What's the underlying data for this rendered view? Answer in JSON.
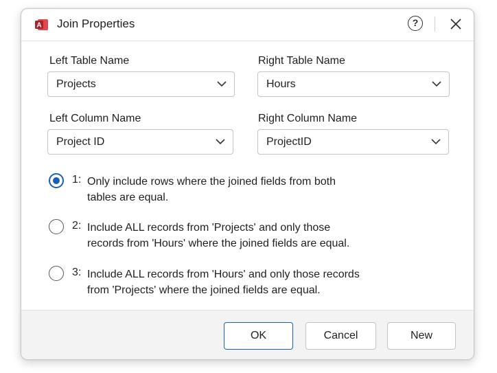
{
  "dialog": {
    "title": "Join Properties",
    "app_icon": "access-app-icon",
    "help_label": "?",
    "close_icon": "close-icon"
  },
  "fields": {
    "left_table_label": "Left Table Name",
    "left_table_value": "Projects",
    "right_table_label": "Right Table Name",
    "right_table_value": "Hours",
    "left_column_label": "Left Column Name",
    "left_column_value": "Project ID",
    "right_column_label": "Right Column Name",
    "right_column_value": "ProjectID"
  },
  "options": [
    {
      "num": "1:",
      "line1": "Only include rows where the joined fields from both",
      "line2": "tables are equal.",
      "selected": true
    },
    {
      "num": "2:",
      "line1": "Include ALL records from 'Projects' and only those",
      "line2": "records from 'Hours' where the joined fields are equal.",
      "selected": false
    },
    {
      "num": "3:",
      "line1": "Include ALL records from 'Hours' and only those records",
      "line2": "from 'Projects' where the joined fields are equal.",
      "selected": false
    }
  ],
  "buttons": {
    "ok": "OK",
    "cancel": "Cancel",
    "new": "New"
  },
  "colors": {
    "accent": "#1a5fb4",
    "app_icon": "#c1272d"
  }
}
